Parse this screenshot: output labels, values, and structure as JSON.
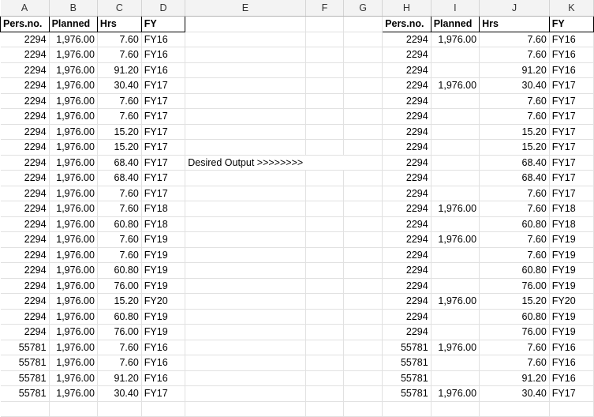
{
  "columns": [
    "A",
    "B",
    "C",
    "D",
    "E",
    "F",
    "G",
    "H",
    "I",
    "J",
    "K"
  ],
  "left_headers": [
    "Pers.no.",
    "Planned",
    "Hrs",
    "FY"
  ],
  "right_headers": [
    "Pers.no.",
    "Planned",
    "Hrs",
    "FY"
  ],
  "note": "Desired Output >>>>>>>>",
  "left_rows": [
    [
      "2294",
      "1,976.00",
      "7.60",
      "FY16"
    ],
    [
      "2294",
      "1,976.00",
      "7.60",
      "FY16"
    ],
    [
      "2294",
      "1,976.00",
      "91.20",
      "FY16"
    ],
    [
      "2294",
      "1,976.00",
      "30.40",
      "FY17"
    ],
    [
      "2294",
      "1,976.00",
      "7.60",
      "FY17"
    ],
    [
      "2294",
      "1,976.00",
      "7.60",
      "FY17"
    ],
    [
      "2294",
      "1,976.00",
      "15.20",
      "FY17"
    ],
    [
      "2294",
      "1,976.00",
      "15.20",
      "FY17"
    ],
    [
      "2294",
      "1,976.00",
      "68.40",
      "FY17"
    ],
    [
      "2294",
      "1,976.00",
      "68.40",
      "FY17"
    ],
    [
      "2294",
      "1,976.00",
      "7.60",
      "FY17"
    ],
    [
      "2294",
      "1,976.00",
      "7.60",
      "FY18"
    ],
    [
      "2294",
      "1,976.00",
      "60.80",
      "FY18"
    ],
    [
      "2294",
      "1,976.00",
      "7.60",
      "FY19"
    ],
    [
      "2294",
      "1,976.00",
      "7.60",
      "FY19"
    ],
    [
      "2294",
      "1,976.00",
      "60.80",
      "FY19"
    ],
    [
      "2294",
      "1,976.00",
      "76.00",
      "FY19"
    ],
    [
      "2294",
      "1,976.00",
      "15.20",
      "FY20"
    ],
    [
      "2294",
      "1,976.00",
      "60.80",
      "FY19"
    ],
    [
      "2294",
      "1,976.00",
      "76.00",
      "FY19"
    ],
    [
      "55781",
      "1,976.00",
      "7.60",
      "FY16"
    ],
    [
      "55781",
      "1,976.00",
      "7.60",
      "FY16"
    ],
    [
      "55781",
      "1,976.00",
      "91.20",
      "FY16"
    ],
    [
      "55781",
      "1,976.00",
      "30.40",
      "FY17"
    ]
  ],
  "right_rows": [
    [
      "2294",
      "1,976.00",
      "7.60",
      "FY16"
    ],
    [
      "2294",
      "",
      "7.60",
      "FY16"
    ],
    [
      "2294",
      "",
      "91.20",
      "FY16"
    ],
    [
      "2294",
      "1,976.00",
      "30.40",
      "FY17"
    ],
    [
      "2294",
      "",
      "7.60",
      "FY17"
    ],
    [
      "2294",
      "",
      "7.60",
      "FY17"
    ],
    [
      "2294",
      "",
      "15.20",
      "FY17"
    ],
    [
      "2294",
      "",
      "15.20",
      "FY17"
    ],
    [
      "2294",
      "",
      "68.40",
      "FY17"
    ],
    [
      "2294",
      "",
      "68.40",
      "FY17"
    ],
    [
      "2294",
      "",
      "7.60",
      "FY17"
    ],
    [
      "2294",
      "1,976.00",
      "7.60",
      "FY18"
    ],
    [
      "2294",
      "",
      "60.80",
      "FY18"
    ],
    [
      "2294",
      "1,976.00",
      "7.60",
      "FY19"
    ],
    [
      "2294",
      "",
      "7.60",
      "FY19"
    ],
    [
      "2294",
      "",
      "60.80",
      "FY19"
    ],
    [
      "2294",
      "",
      "76.00",
      "FY19"
    ],
    [
      "2294",
      "1,976.00",
      "15.20",
      "FY20"
    ],
    [
      "2294",
      "",
      "60.80",
      "FY19"
    ],
    [
      "2294",
      "",
      "76.00",
      "FY19"
    ],
    [
      "55781",
      "1,976.00",
      "7.60",
      "FY16"
    ],
    [
      "55781",
      "",
      "7.60",
      "FY16"
    ],
    [
      "55781",
      "",
      "91.20",
      "FY16"
    ],
    [
      "55781",
      "1,976.00",
      "30.40",
      "FY17"
    ]
  ]
}
